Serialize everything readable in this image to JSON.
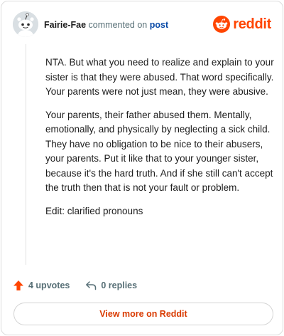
{
  "comment": {
    "author": "Fairie-Fae",
    "action_text": "commented on",
    "post_link": "post",
    "paragraphs": [
      "NTA. But what you need to realize and explain to your sister is that they were abused. That word specifically. Your parents were not just mean, they were abusive.",
      "Your parents, their father abused them. Mentally, emotionally, and physically by neglecting a sick child. They have no obligation to be nice to their abusers, your parents. Put it like that to your younger sister, because it's the hard truth. And if she still can't accept the truth then that is not your fault or problem.",
      "Edit: clarified pronouns"
    ]
  },
  "brand": {
    "name": "reddit",
    "color": "#ff4500"
  },
  "stats": {
    "upvotes": "4 upvotes",
    "replies": "0 replies"
  },
  "cta": {
    "label": "View more on Reddit"
  },
  "icons": {
    "avatar": "snoo-avatar-icon",
    "logo": "reddit-alien-icon",
    "upvote": "upvote-arrow-icon",
    "reply": "reply-arrow-icon"
  }
}
